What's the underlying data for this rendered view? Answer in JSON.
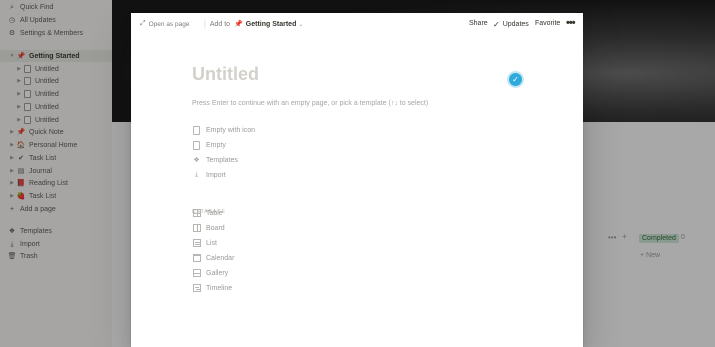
{
  "sidebar": {
    "items": [
      {
        "label": "Quick Find",
        "icon": "search-icon",
        "glyph": "⌕"
      },
      {
        "label": "All Updates",
        "icon": "clock-icon",
        "glyph": "◷"
      },
      {
        "label": "Settings & Members",
        "icon": "gear-icon",
        "glyph": "⚙"
      }
    ],
    "tree": [
      {
        "label": "Getting Started",
        "icon": "pushpin-icon",
        "glyph": "📌",
        "expanded": true
      },
      {
        "label": "Untitled"
      },
      {
        "label": "Untitled"
      },
      {
        "label": "Untitled"
      },
      {
        "label": "Untitled"
      },
      {
        "label": "Untitled"
      },
      {
        "label": "Quick Note",
        "icon": "pushpin-icon",
        "glyph": "📌"
      },
      {
        "label": "Personal Home",
        "icon": "house-icon",
        "glyph": "🏠"
      },
      {
        "label": "Task List",
        "icon": "checkmark-icon",
        "glyph": "✔"
      },
      {
        "label": "Journal",
        "icon": "notebook-icon",
        "glyph": "▤"
      },
      {
        "label": "Reading List",
        "icon": "books-icon",
        "glyph": "📕"
      },
      {
        "label": "Task List",
        "icon": "strawberry-icon",
        "glyph": "🍓"
      }
    ],
    "add_page": "Add a page",
    "bottom": [
      {
        "label": "Templates",
        "icon": "templates-icon",
        "glyph": "❖"
      },
      {
        "label": "Import",
        "icon": "import-icon",
        "glyph": "⤓"
      },
      {
        "label": "Trash",
        "icon": "trash-icon",
        "glyph": "🗑"
      }
    ]
  },
  "background": {
    "column_status": "Completed",
    "column_count": "0",
    "new_label": "+ New"
  },
  "modal": {
    "open_as_page": "Open as page",
    "add_to": "Add to",
    "add_to_target": "Getting Started",
    "share": "Share",
    "updates": "Updates",
    "favorite": "Favorite",
    "more": "•••",
    "title_placeholder": "Untitled",
    "hint": "Press Enter to continue with an empty page, or pick a template (↑↓ to select)",
    "options": [
      {
        "label": "Empty with icon",
        "icon": "page-with-icon"
      },
      {
        "label": "Empty",
        "icon": "page-icon"
      },
      {
        "label": "Templates",
        "icon": "templates-icon"
      },
      {
        "label": "Import",
        "icon": "import-icon"
      }
    ],
    "database_label": "DATABASE",
    "database_options": [
      {
        "label": "Table",
        "icon": "table-icon"
      },
      {
        "label": "Board",
        "icon": "board-icon"
      },
      {
        "label": "List",
        "icon": "list-icon"
      },
      {
        "label": "Calendar",
        "icon": "calendar-icon"
      },
      {
        "label": "Gallery",
        "icon": "gallery-icon"
      },
      {
        "label": "Timeline",
        "icon": "timeline-icon"
      }
    ]
  },
  "colors": {
    "overlay": "#0f0f0f",
    "accent_blue": "#2eaadc",
    "completed_tag": "#cfe7d4"
  }
}
